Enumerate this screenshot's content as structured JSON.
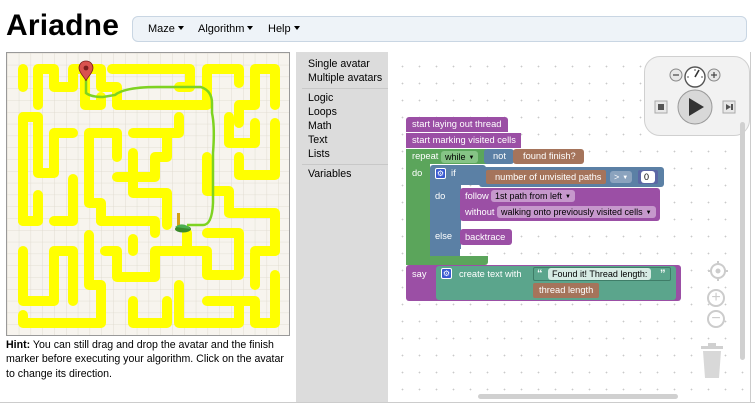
{
  "app": {
    "title": "Ariadne"
  },
  "nav": [
    {
      "label": "Maze"
    },
    {
      "label": "Algorithm"
    },
    {
      "label": "Help"
    }
  ],
  "hint": {
    "label": "Hint:",
    "text": " You can still drag and drop the avatar and the finish marker before executing your algorithm. Click on the avatar to change its direction."
  },
  "toolbox": {
    "groups": [
      [
        "Single avatar",
        "Multiple avatars"
      ],
      [
        "Logic",
        "Loops",
        "Math",
        "Text",
        "Lists"
      ],
      [
        "Variables"
      ]
    ]
  },
  "blocks": {
    "start_laying": "start laying out thread",
    "start_marking": "start marking visited cells",
    "repeat": "repeat",
    "while": "while",
    "not": "not",
    "found_finish": "found finish?",
    "do": "do",
    "if": "if",
    "num_unvisited": "number of unvisited paths",
    "op": ">",
    "zero": "0",
    "do2": "do",
    "follow": "follow",
    "first_path": "1st path from left",
    "without": "without",
    "walking_onto": "walking onto previously visited cells",
    "else": "else",
    "backtrace": "backtrace",
    "say": "say",
    "create_text": "create text with",
    "found_it": "Found it! Thread length:",
    "thread_length": "thread length"
  },
  "colors": {
    "maze_path": "#ffff00",
    "thread": "#7ed321",
    "avatar": "#3a8a2a",
    "marker": "#d9534f",
    "procedure_block": "#9b4fa5",
    "loop_block": "#5ba55b",
    "logic_block": "#5b80a5",
    "sensor_block": "#a5745b",
    "text_block": "#5ba58c",
    "math_block": "#5b67a5"
  }
}
